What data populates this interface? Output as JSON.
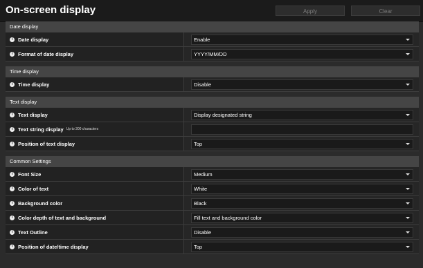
{
  "header": {
    "title": "On-screen display",
    "apply_label": "Apply",
    "clear_label": "Clear"
  },
  "sections": {
    "date": {
      "title": "Date display",
      "rows": [
        {
          "label": "Date display",
          "value": "Enable"
        },
        {
          "label": "Format of date display",
          "value": "YYYY/MM/DD"
        }
      ]
    },
    "time": {
      "title": "Time display",
      "rows": [
        {
          "label": "Time display",
          "value": "Disable"
        }
      ]
    },
    "text": {
      "title": "Text display",
      "rows": [
        {
          "label": "Text display",
          "value": "Display designated string"
        },
        {
          "label": "Text string display",
          "hint": "Up to 300 characters",
          "value": ""
        },
        {
          "label": "Position of text display",
          "value": "Top"
        }
      ]
    },
    "common": {
      "title": "Common Settings",
      "rows": [
        {
          "label": "Font Size",
          "value": "Medium"
        },
        {
          "label": "Color of text",
          "value": "White"
        },
        {
          "label": "Background color",
          "value": "Black"
        },
        {
          "label": "Color depth of text and background",
          "value": "Fill text and background color"
        },
        {
          "label": "Text Outline",
          "value": "Disable"
        },
        {
          "label": "Position of date/time display",
          "value": "Top"
        }
      ]
    }
  },
  "icons": {
    "info": "info-icon",
    "dropdown": "chevron-down-icon"
  }
}
